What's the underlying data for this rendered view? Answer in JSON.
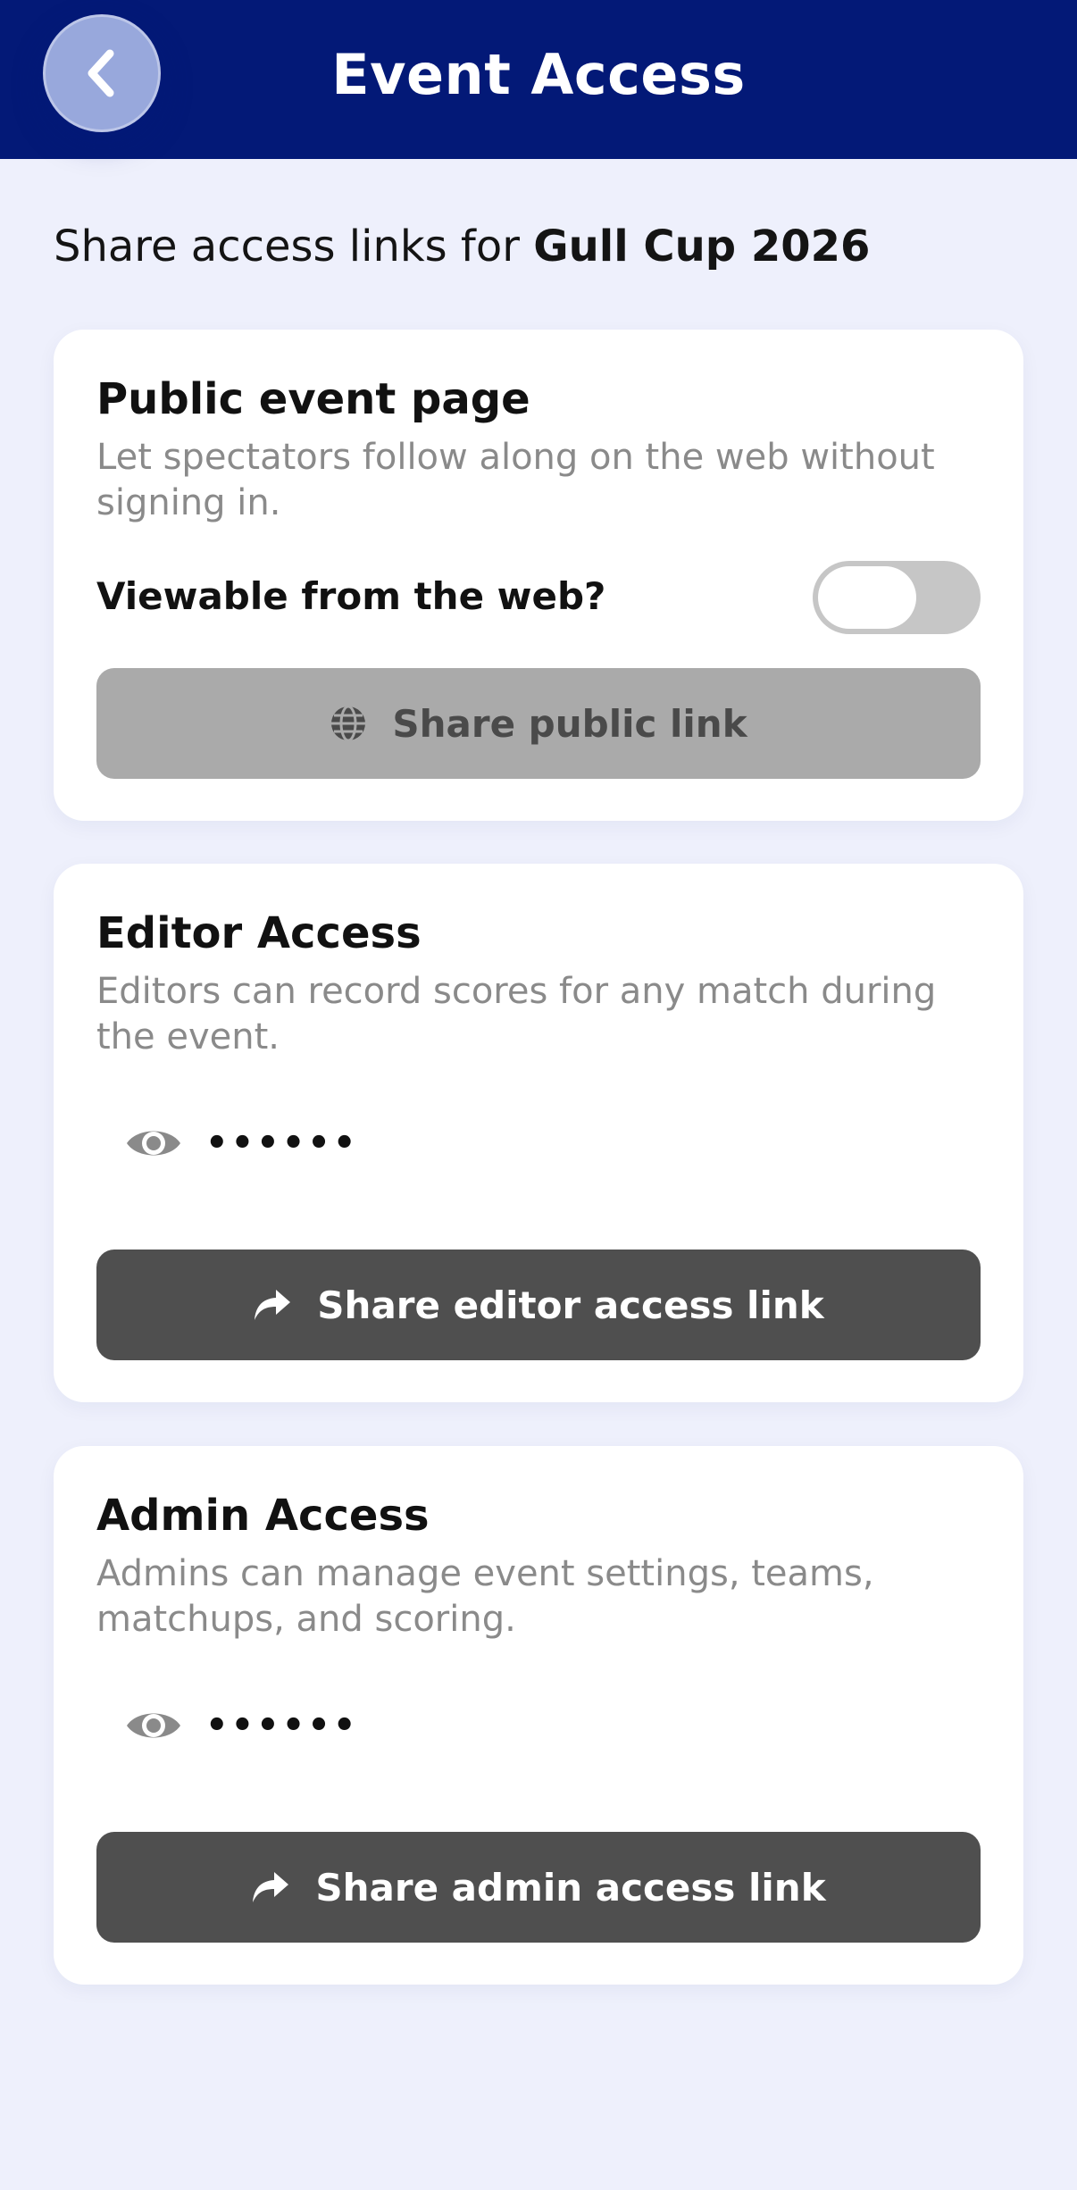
{
  "header": {
    "title": "Event Access",
    "back_icon": "chevron-left-icon"
  },
  "intro": {
    "prefix": "Share access links for ",
    "event_name": "Gull Cup 2026"
  },
  "public_card": {
    "title": "Public event page",
    "description": "Let spectators follow along on the web without signing in.",
    "toggle_label": "Viewable from the web?",
    "toggle_on": false,
    "button_label": "Share public link",
    "button_icon": "globe-icon"
  },
  "editor_card": {
    "title": "Editor Access",
    "description": "Editors can record scores for any match during the event.",
    "secret_masked": "••••••",
    "reveal_icon": "eye-icon",
    "button_label": "Share editor access link",
    "button_icon": "share-arrow-icon"
  },
  "admin_card": {
    "title": "Admin Access",
    "description": "Admins can manage event settings, teams, matchups, and scoring.",
    "secret_masked": "••••••",
    "reveal_icon": "eye-icon",
    "button_label": "Share admin access link",
    "button_icon": "share-arrow-icon"
  },
  "colors": {
    "header_bg": "#031977",
    "page_bg": "#eef0fc",
    "disabled_button": "#aaaaaa",
    "dark_button": "#4f4f4f"
  }
}
